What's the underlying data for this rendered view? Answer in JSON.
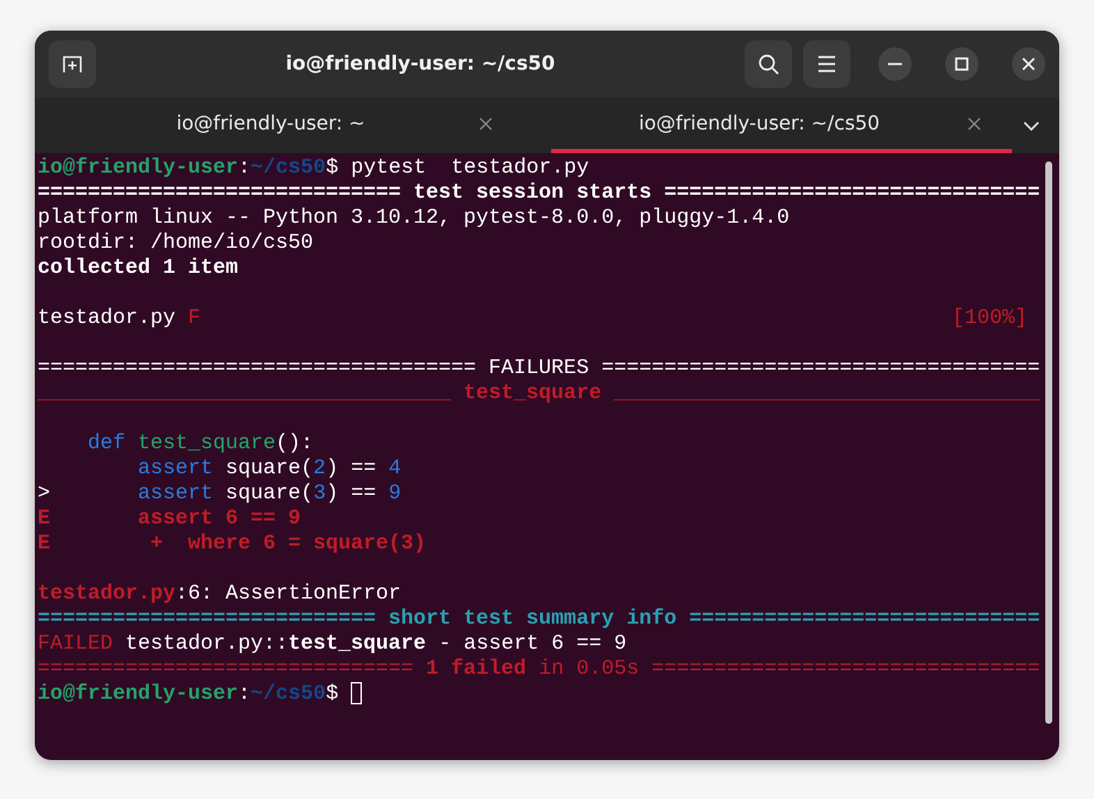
{
  "window": {
    "title": "io@friendly-user: ~/cs50"
  },
  "tabs": [
    {
      "label": "io@friendly-user: ~",
      "selected": false
    },
    {
      "label": "io@friendly-user: ~/cs50",
      "selected": true
    }
  ],
  "terminal": {
    "blocks": [
      {
        "lines": [
          {
            "segments": [
              {
                "text": "io@friendly-user",
                "kind": "user"
              },
              {
                "text": ":",
                "kind": "plain"
              },
              {
                "text": "~/cs50",
                "kind": "path"
              },
              {
                "text": "$ pytest  testador.py",
                "kind": "plain"
              }
            ]
          },
          {
            "segments": [
              {
                "text": "============================= test session starts ==============================",
                "kind": "bold"
              }
            ]
          },
          {
            "segments": [
              {
                "text": "platform linux -- Python 3.10.12, pytest-8.0.0, pluggy-1.4.0",
                "kind": "plain"
              }
            ]
          },
          {
            "segments": [
              {
                "text": "rootdir: /home/io/cs50",
                "kind": "plain"
              }
            ]
          },
          {
            "segments": [
              {
                "text": "collected 1 item",
                "kind": "bold"
              }
            ]
          }
        ]
      },
      {
        "lines": [
          {
            "segments": [
              {
                "text": "testador.py",
                "kind": "plain"
              },
              {
                "text": " F",
                "kind": "red"
              }
            ],
            "right": [
              {
                "text": "[100%]",
                "kind": "red"
              }
            ]
          }
        ]
      },
      {
        "lines": [
          {
            "segments": [
              {
                "text": "=================================== FAILURES ===================================",
                "kind": "plain"
              }
            ]
          },
          {
            "segments": [
              {
                "text": "_________________________________ test_square __________________________________",
                "kind": "redbold"
              }
            ]
          }
        ]
      },
      {
        "lines": [
          {
            "segments": [
              {
                "text": "    def",
                "kind": "blue"
              },
              {
                "text": " test_square",
                "kind": "green"
              },
              {
                "text": "():",
                "kind": "plain"
              }
            ]
          },
          {
            "segments": [
              {
                "text": "        assert",
                "kind": "blue"
              },
              {
                "text": " square(",
                "kind": "plain"
              },
              {
                "text": "2",
                "kind": "blue"
              },
              {
                "text": ") ==",
                "kind": "plain"
              },
              {
                "text": " 4",
                "kind": "blue"
              }
            ]
          },
          {
            "segments": [
              {
                "text": ">",
                "kind": "plain"
              },
              {
                "text": "       assert",
                "kind": "blue"
              },
              {
                "text": " square(",
                "kind": "plain"
              },
              {
                "text": "3",
                "kind": "blue"
              },
              {
                "text": ") ==",
                "kind": "plain"
              },
              {
                "text": " 9",
                "kind": "blue"
              }
            ]
          },
          {
            "segments": [
              {
                "text": "E       assert 6 == 9",
                "kind": "redbold"
              }
            ]
          },
          {
            "segments": [
              {
                "text": "E        +  where 6 = square(3)",
                "kind": "redbold"
              }
            ]
          }
        ]
      },
      {
        "lines": [
          {
            "segments": [
              {
                "text": "testador.py",
                "kind": "redbold"
              },
              {
                "text": ":6: AssertionError",
                "kind": "plain"
              }
            ]
          },
          {
            "segments": [
              {
                "text": "=========================== short test summary info ============================",
                "kind": "cyanbold"
              }
            ]
          },
          {
            "segments": [
              {
                "text": "FAILED",
                "kind": "red"
              },
              {
                "text": " testador.py::",
                "kind": "plain"
              },
              {
                "text": "test_square",
                "kind": "bold"
              },
              {
                "text": " - assert 6 == 9",
                "kind": "plain"
              }
            ]
          },
          {
            "segments": [
              {
                "text": "==============================",
                "kind": "red"
              },
              {
                "text": " 1 failed",
                "kind": "redbold"
              },
              {
                "text": " in 0.05s ===============================",
                "kind": "red"
              }
            ]
          },
          {
            "segments": [
              {
                "text": "io@friendly-user",
                "kind": "user"
              },
              {
                "text": ":",
                "kind": "plain"
              },
              {
                "text": "~/cs50",
                "kind": "path"
              },
              {
                "text": "$",
                "kind": "plain"
              }
            ],
            "cursor": true
          }
        ]
      }
    ]
  }
}
